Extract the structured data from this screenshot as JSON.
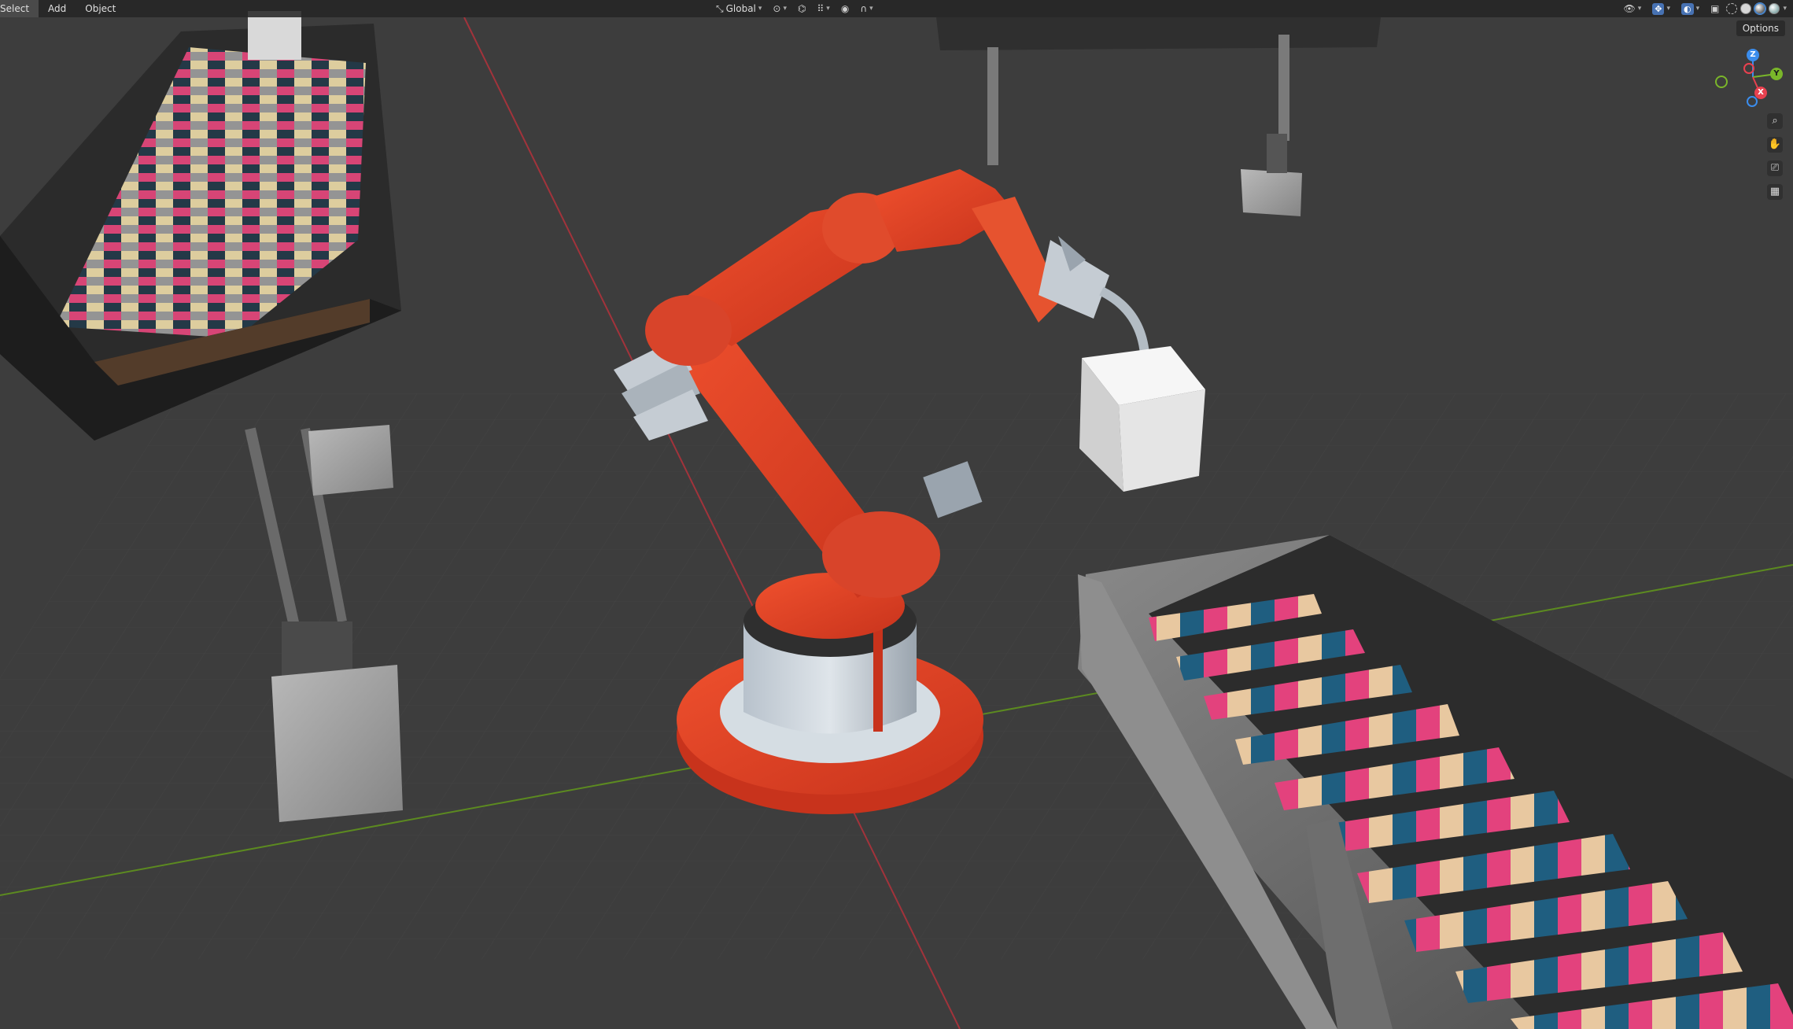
{
  "header": {
    "menus": [
      "Select",
      "Add",
      "Object"
    ],
    "transform_orientation": "Global",
    "options_label": "Options"
  },
  "gizmo": {
    "axes": {
      "x": "X",
      "y": "Y",
      "z": "Z"
    },
    "colors": {
      "x": "#e8414f",
      "y": "#7ab62a",
      "z": "#3b8ded"
    }
  },
  "icons": {
    "orientation": "transform-orientation-icon",
    "pivot": "pivot-point-icon",
    "snap": "snap-icon",
    "proportional": "proportional-editing-icon",
    "visibility": "selectability-visibility-icon",
    "gizmo": "viewport-gizmos-icon",
    "overlay": "overlays-icon",
    "xray": "xray-icon",
    "zoom": "zoom-icon",
    "pan": "pan-hand-icon",
    "camera": "camera-view-icon",
    "grid": "perspective-toggle-icon"
  },
  "scene": {
    "background": "#3d3d3d",
    "robot_color": "#e2412a",
    "cube_color": "#eeeeee"
  }
}
